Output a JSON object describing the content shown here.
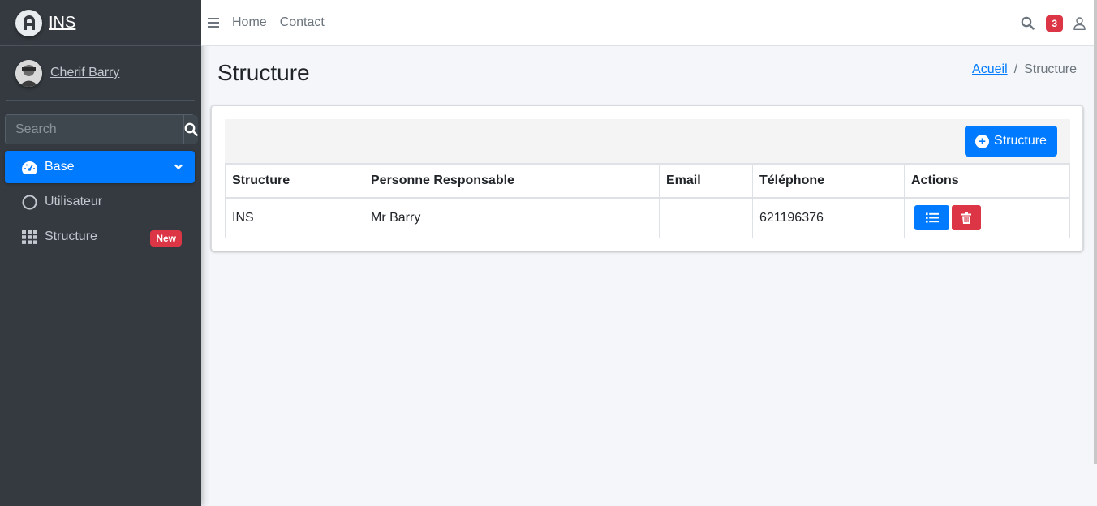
{
  "brand": {
    "name": "INS"
  },
  "user": {
    "name": "Cherif Barry"
  },
  "sidebar": {
    "search_placeholder": "Search",
    "items": [
      {
        "label": "Base",
        "icon": "dashboard-icon",
        "active": true
      },
      {
        "label": "Utilisateur",
        "icon": "circle-icon"
      },
      {
        "label": "Structure",
        "icon": "grid-icon",
        "badge": "New"
      }
    ]
  },
  "navbar": {
    "links": [
      "Home",
      "Contact"
    ],
    "notification_count": "3"
  },
  "page": {
    "title": "Structure",
    "breadcrumb": {
      "home": "Acueil",
      "current": "Structure"
    }
  },
  "toolbar": {
    "add_label": "Structure"
  },
  "table": {
    "headers": [
      "Structure",
      "Personne Responsable",
      "Email",
      "Téléphone",
      "Actions"
    ],
    "rows": [
      {
        "structure": "INS",
        "responsable": "Mr Barry",
        "email": "",
        "telephone": "621196376"
      }
    ]
  },
  "colors": {
    "primary": "#007bff",
    "danger": "#dc3545",
    "sidebar_bg": "#343a40"
  }
}
